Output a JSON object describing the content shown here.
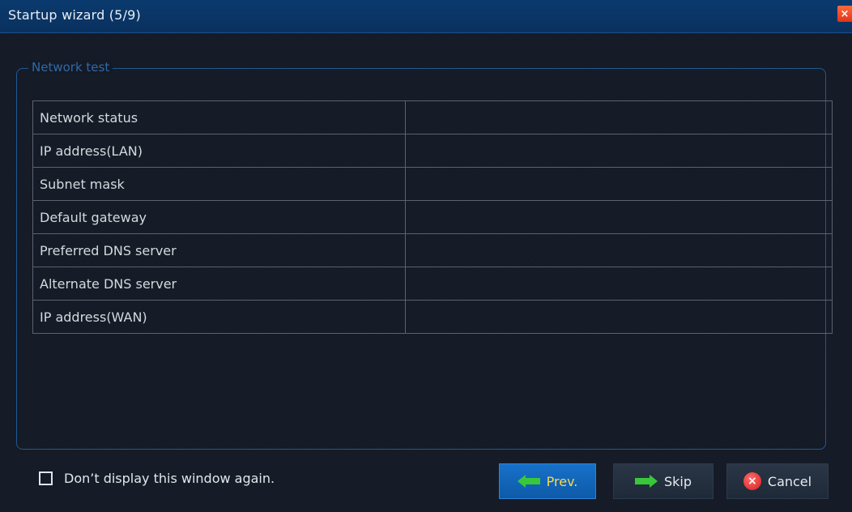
{
  "window": {
    "title": "Startup wizard (5/9)",
    "close_symbol": "×"
  },
  "group": {
    "legend": "Network test"
  },
  "network_table": {
    "rows": [
      {
        "label": "Network status",
        "value": ""
      },
      {
        "label": "IP address(LAN)",
        "value": ""
      },
      {
        "label": "Subnet mask",
        "value": ""
      },
      {
        "label": "Default gateway",
        "value": ""
      },
      {
        "label": "Preferred DNS server",
        "value": ""
      },
      {
        "label": "Alternate DNS server",
        "value": ""
      },
      {
        "label": "IP address(WAN)",
        "value": ""
      }
    ]
  },
  "footer": {
    "dont_show_label": "Don’t display this window again.",
    "dont_show_checked": false,
    "prev_label": "Prev.",
    "skip_label": "Skip",
    "cancel_label": "Cancel",
    "cancel_symbol": "×"
  },
  "colors": {
    "titlebar": "#0a3a6e",
    "accent_blue": "#1771c9",
    "prev_text": "#ffd84a",
    "arrow_green": "#38c83a",
    "close_red": "#e0341a"
  },
  "icons": {
    "close": "close-icon",
    "prev": "arrow-left-icon",
    "skip": "arrow-right-icon",
    "cancel": "cancel-circle-icon",
    "checkbox": "checkbox-icon"
  }
}
